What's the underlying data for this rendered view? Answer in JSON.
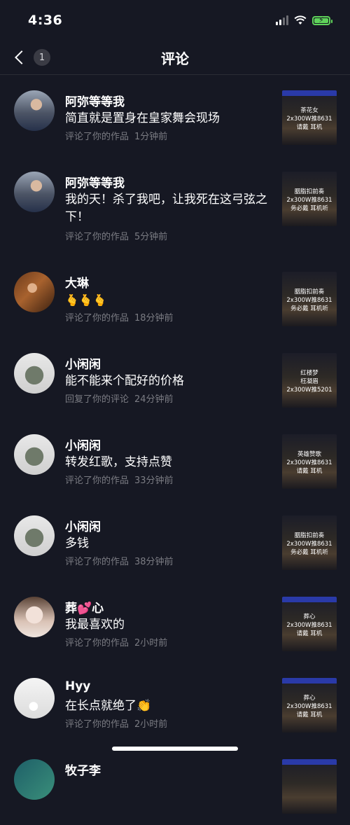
{
  "status": {
    "time": "4:36"
  },
  "nav": {
    "title": "评论",
    "badge": "1"
  },
  "items": [
    {
      "user": "阿弥等等我",
      "comment": "简直就是置身在皇家舞会现场",
      "action": "评论了你的作品",
      "time": "1分钟前",
      "thumb": [
        "茶花女",
        "2x300W推8631",
        "请戴  耳机"
      ]
    },
    {
      "user": "阿弥等等我",
      "comment": "我的天！杀了我吧，让我死在这弓弦之下！",
      "action": "评论了你的作品",
      "time": "5分钟前",
      "thumb": [
        "胭脂扣前奏",
        "2x300W推8631",
        "务必戴  耳机听"
      ]
    },
    {
      "user": "大琳",
      "comment": "🫰🫰🫰",
      "action": "评论了你的作品",
      "time": "18分钟前",
      "thumb": [
        "胭脂扣前奏",
        "2x300W推8631",
        "务必戴  耳机听"
      ]
    },
    {
      "user": "小闲闲",
      "comment": "能不能来个配好的价格",
      "action": "回复了你的评论",
      "time": "24分钟前",
      "thumb": [
        "红楼梦",
        "枉凝眉",
        "2x300W推5201"
      ]
    },
    {
      "user": "小闲闲",
      "comment": "转发红歌，支持点赞",
      "action": "评论了你的作品",
      "time": "33分钟前",
      "thumb": [
        "英雄赞歌",
        "2x300W推8631",
        "请戴  耳机"
      ]
    },
    {
      "user": "小闲闲",
      "comment": "多钱",
      "action": "评论了你的作品",
      "time": "38分钟前",
      "thumb": [
        "胭脂扣前奏",
        "2x300W推8631",
        "务必戴  耳机听"
      ]
    },
    {
      "user": "葬💕心",
      "comment": "我最喜欢的",
      "action": "评论了你的作品",
      "time": "2小时前",
      "thumb": [
        "葬心",
        "2x300W推8631",
        "请戴  耳机"
      ]
    },
    {
      "user": "Hyy",
      "comment": "在长点就绝了👏",
      "action": "评论了你的作品",
      "time": "2小时前",
      "thumb": [
        "葬心",
        "2x300W推8631",
        "请戴  耳机"
      ]
    },
    {
      "user": "牧子李",
      "comment": "",
      "action": "",
      "time": "",
      "thumb": [
        "",
        "",
        ""
      ]
    }
  ]
}
